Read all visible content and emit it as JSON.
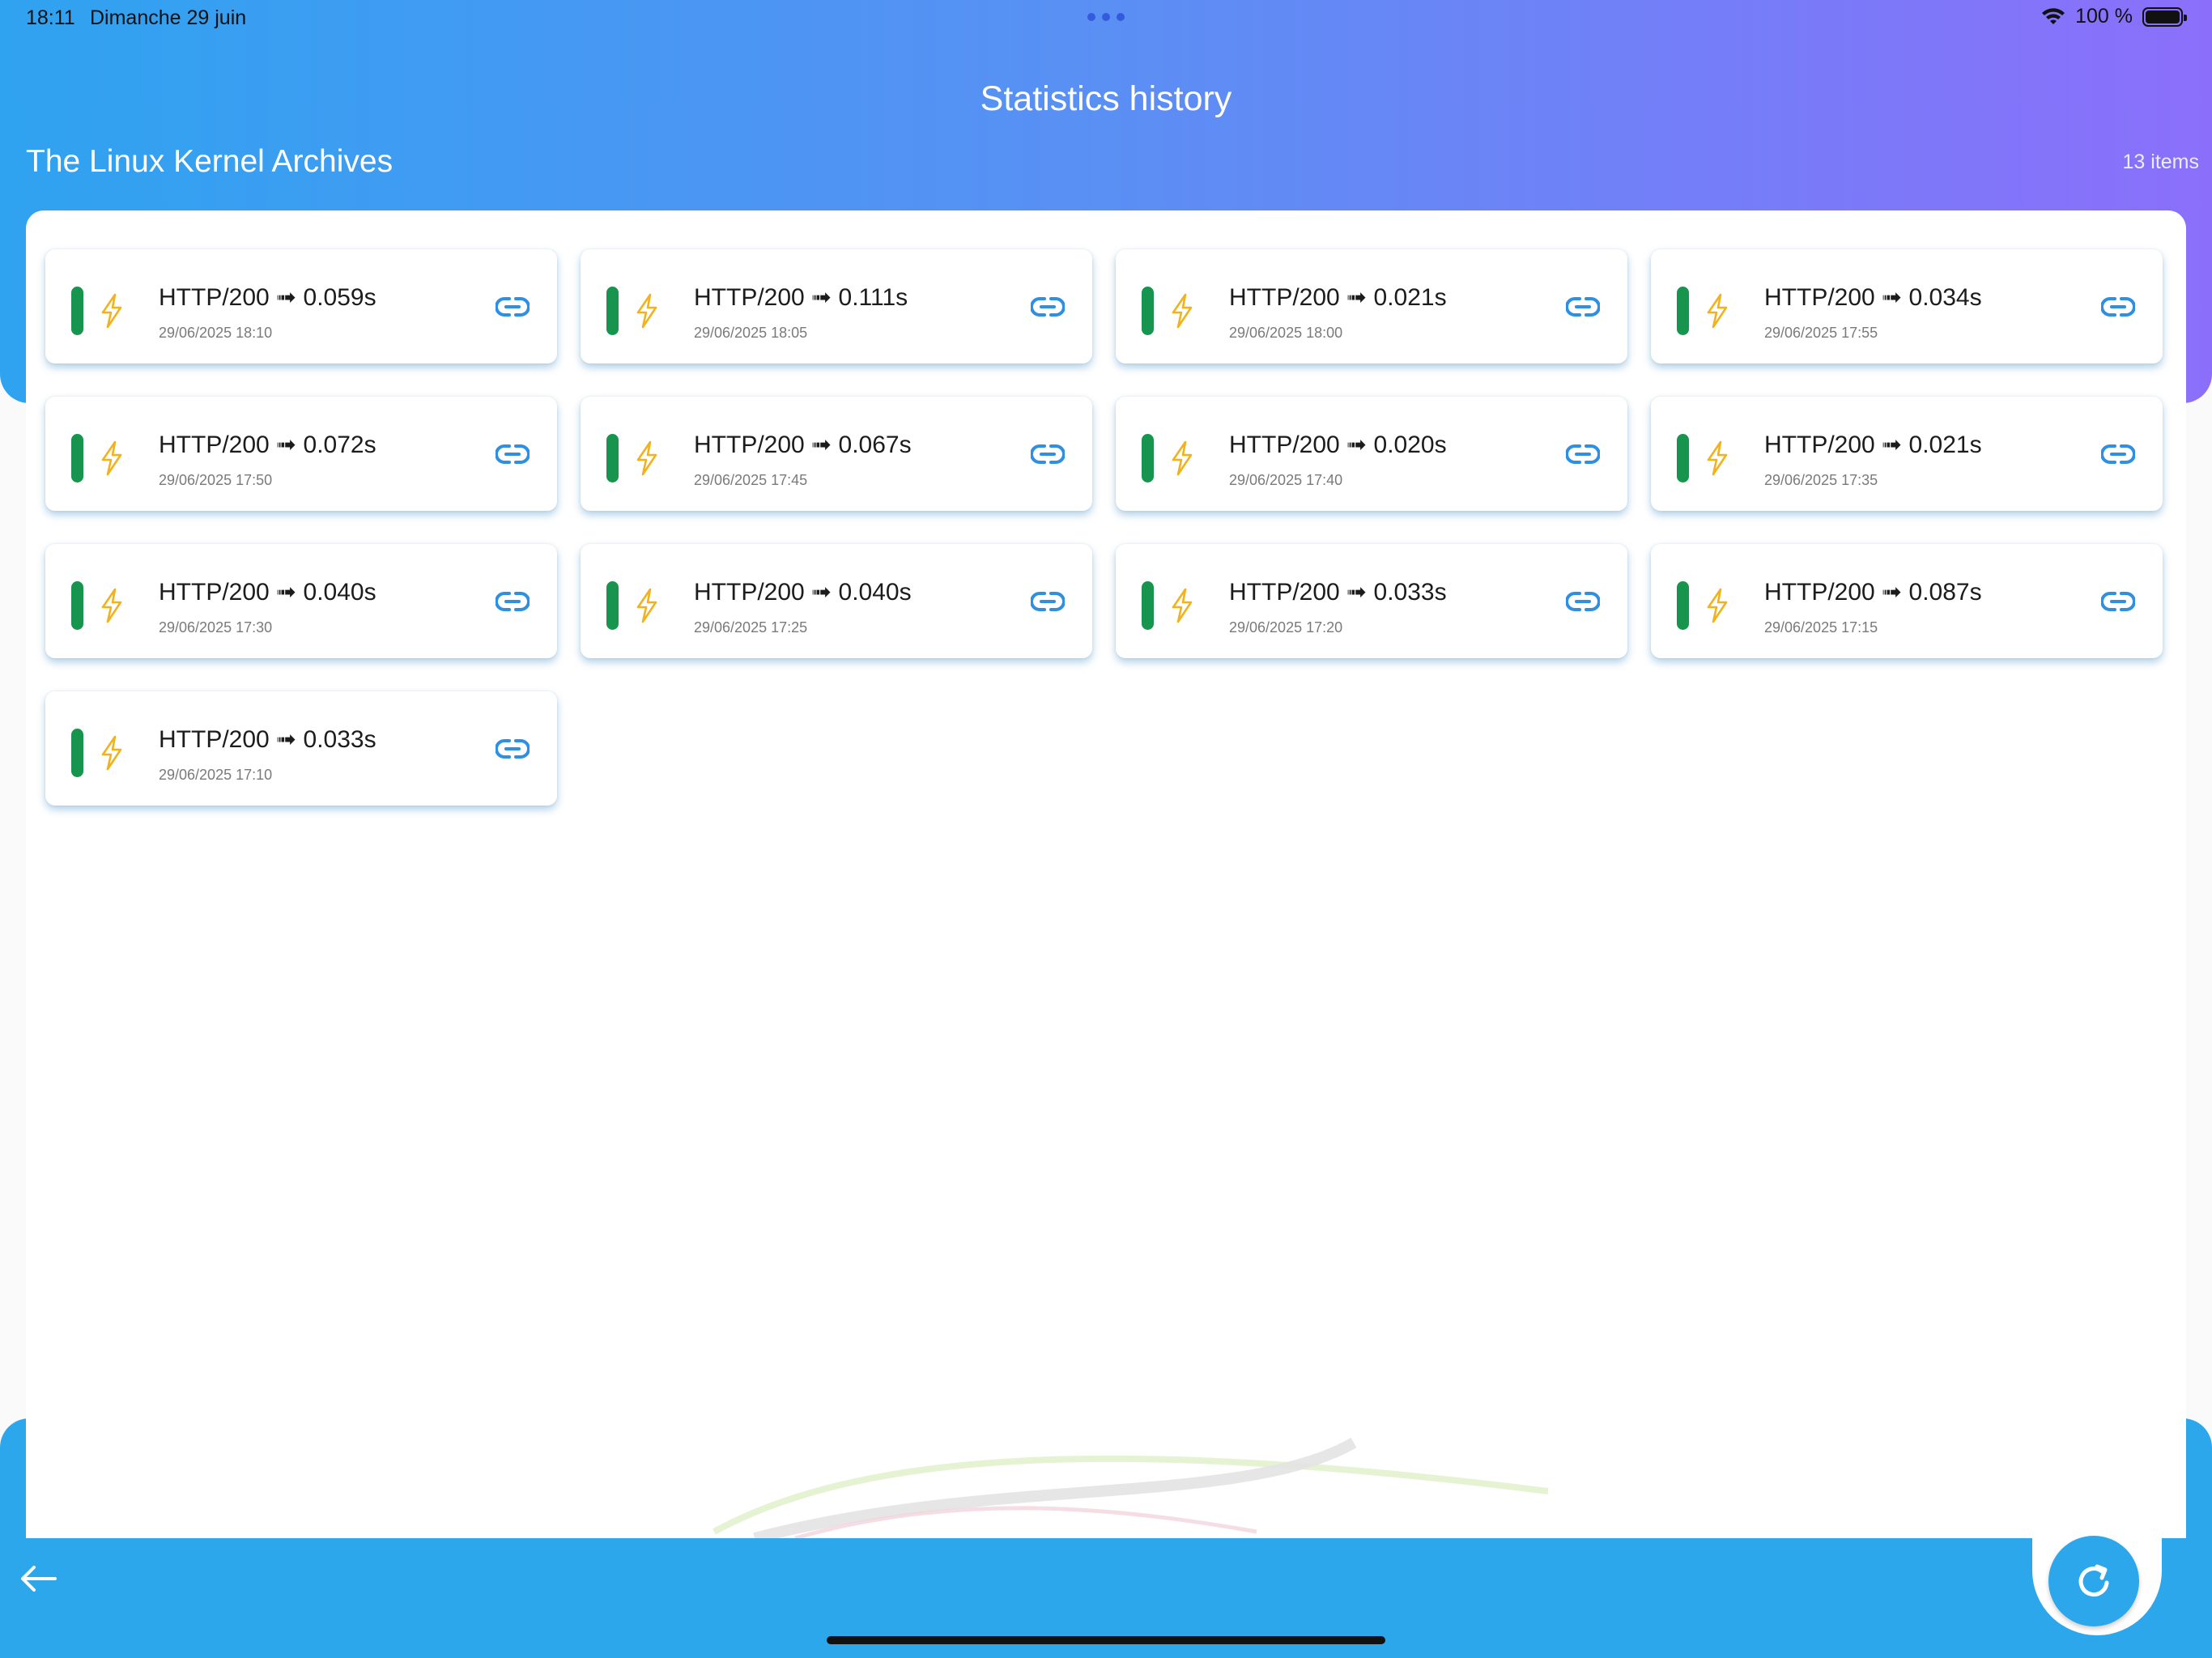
{
  "status_bar": {
    "time": "18:11",
    "date": "Dimanche 29 juin",
    "battery": "100 %"
  },
  "header": {
    "title": "Statistics history",
    "site_name": "The Linux Kernel Archives",
    "count": "13 items"
  },
  "colors": {
    "gradient_start": "#2fa3f0",
    "gradient_end": "#8b6ffb",
    "status_ok": "#17954e",
    "bolt": "#f2b21c",
    "link": "#2f8fe0",
    "bottom_bar": "#2da7ec"
  },
  "entries": [
    {
      "title": "HTTP/200 ➟ 0.059s",
      "date": "29/06/2025 18:10"
    },
    {
      "title": "HTTP/200 ➟ 0.111s",
      "date": "29/06/2025 18:05"
    },
    {
      "title": "HTTP/200 ➟ 0.021s",
      "date": "29/06/2025 18:00"
    },
    {
      "title": "HTTP/200 ➟ 0.034s",
      "date": "29/06/2025 17:55"
    },
    {
      "title": "HTTP/200 ➟ 0.072s",
      "date": "29/06/2025 17:50"
    },
    {
      "title": "HTTP/200 ➟ 0.067s",
      "date": "29/06/2025 17:45"
    },
    {
      "title": "HTTP/200 ➟ 0.020s",
      "date": "29/06/2025 17:40"
    },
    {
      "title": "HTTP/200 ➟ 0.021s",
      "date": "29/06/2025 17:35"
    },
    {
      "title": "HTTP/200 ➟ 0.040s",
      "date": "29/06/2025 17:30"
    },
    {
      "title": "HTTP/200 ➟ 0.040s",
      "date": "29/06/2025 17:25"
    },
    {
      "title": "HTTP/200 ➟ 0.033s",
      "date": "29/06/2025 17:20"
    },
    {
      "title": "HTTP/200 ➟ 0.087s",
      "date": "29/06/2025 17:15"
    },
    {
      "title": "HTTP/200 ➟ 0.033s",
      "date": "29/06/2025 17:10"
    }
  ],
  "icons": {
    "status": "status-bar-icon",
    "bolt": "bolt-icon",
    "link": "link-icon",
    "back": "arrow-left-icon",
    "refresh": "refresh-icon"
  }
}
